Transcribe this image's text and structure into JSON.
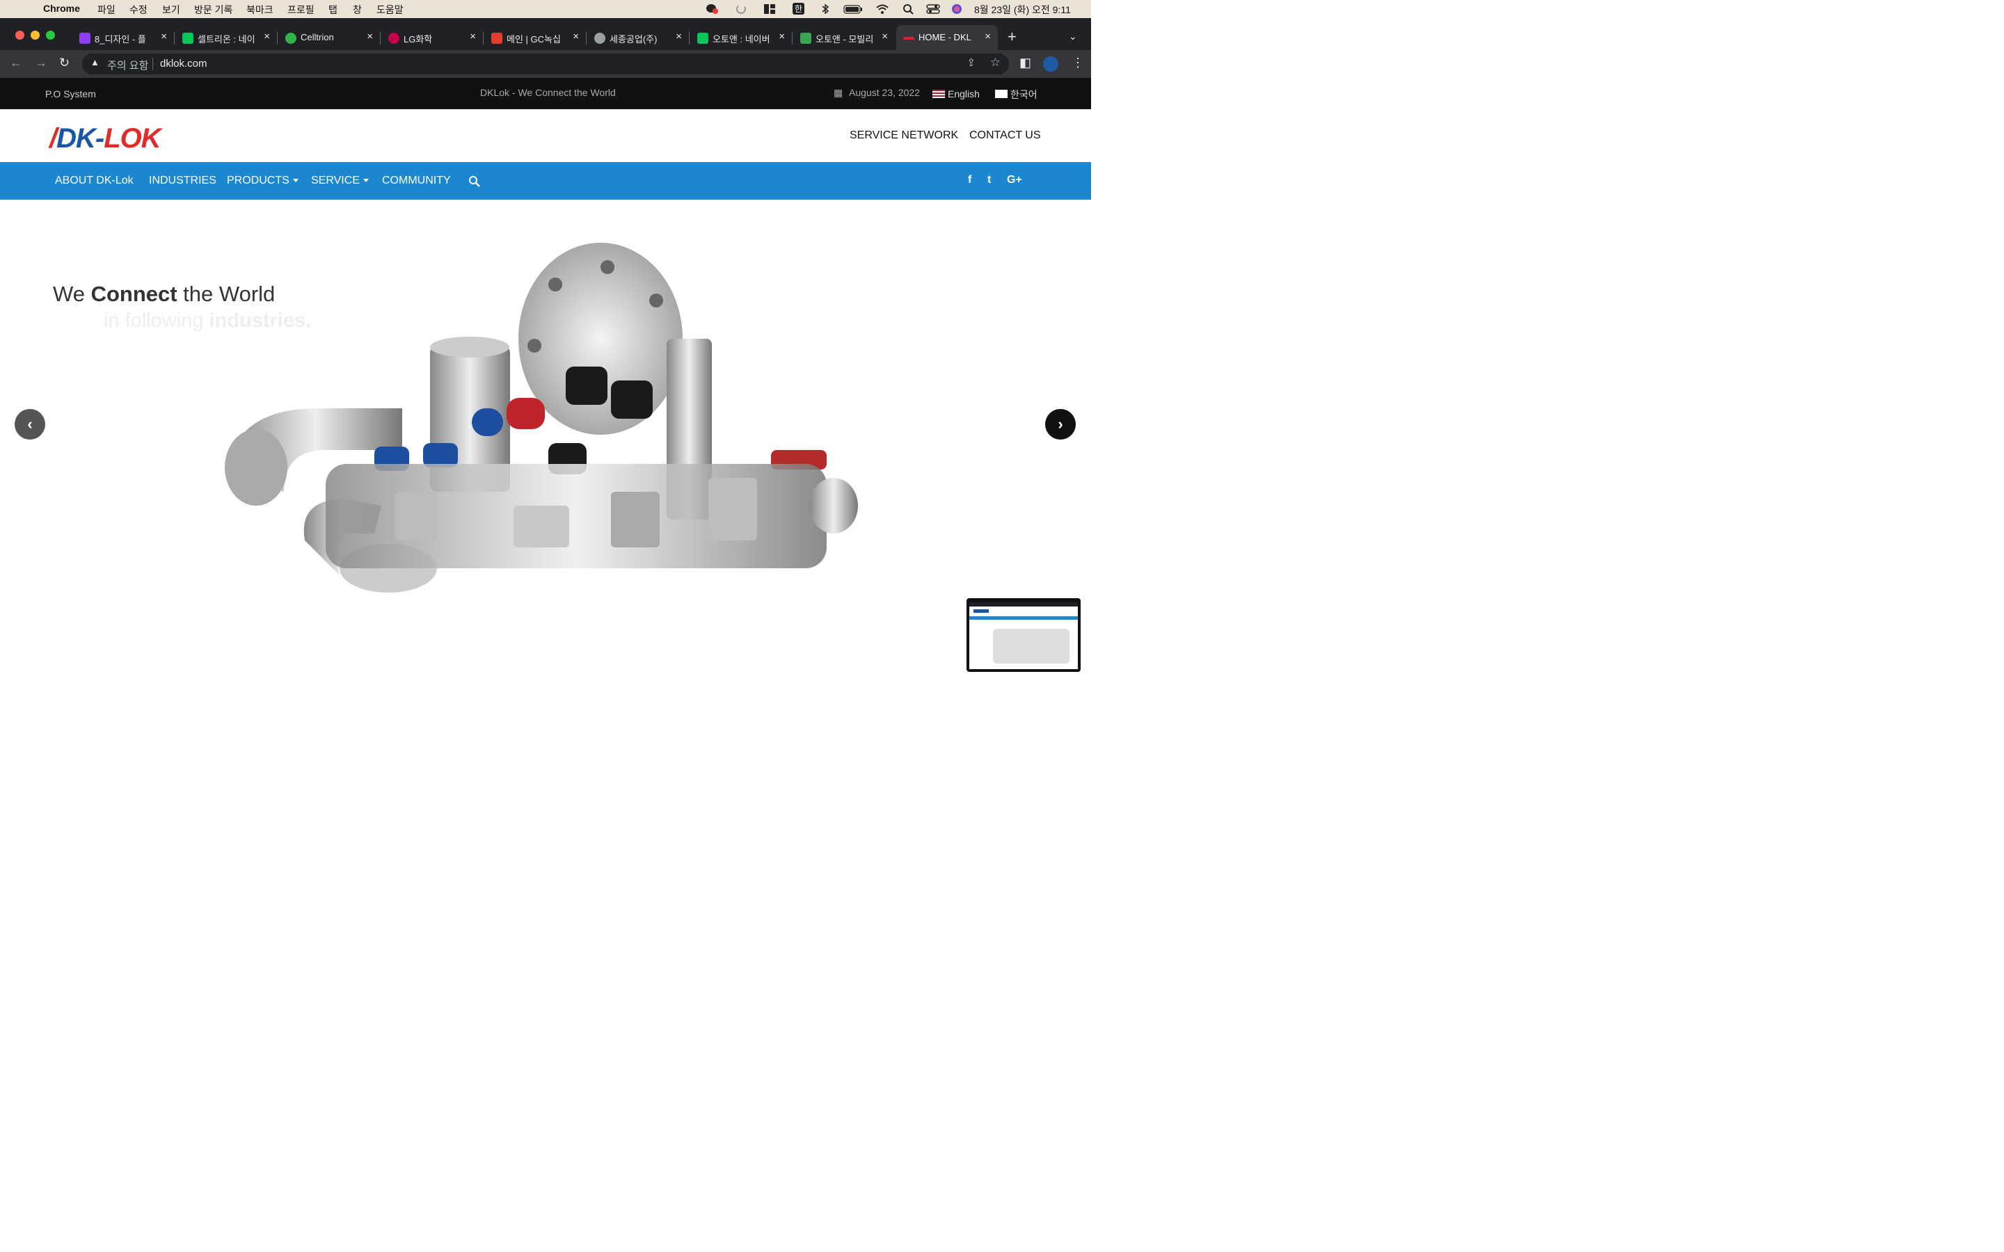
{
  "menubar": {
    "app_name": "Chrome",
    "menus": [
      "파일",
      "수정",
      "보기",
      "방문 기록",
      "북마크",
      "프로필",
      "탭",
      "창",
      "도움말"
    ],
    "ime_indicator": "한",
    "datetime": "8월 23일 (화) 오전 9:11"
  },
  "browser": {
    "tabs": [
      {
        "title": "8_디자인 - 플",
        "favicon_color": "#8e3ff5"
      },
      {
        "title": "셀트리온 : 네이",
        "favicon_color": "#03c75a"
      },
      {
        "title": "Celltrion",
        "favicon_color": "#32b44a"
      },
      {
        "title": "LG화학",
        "favicon_color": "#c5004f"
      },
      {
        "title": "메인 | GC녹십",
        "favicon_color": "#e63c2f"
      },
      {
        "title": "세종공업(주)",
        "favicon_color": "#9aa0a6"
      },
      {
        "title": "오토앤 : 네이버",
        "favicon_color": "#03c75a"
      },
      {
        "title": "오토앤 - 모빌리",
        "favicon_color": "#3aa655"
      },
      {
        "title": "HOME - DKL",
        "favicon_color": "#d6262b"
      }
    ],
    "security_label": "주의 요함",
    "url": "dklok.com"
  },
  "site": {
    "topbar": {
      "po_system": "P.O System",
      "tagline": "DKLok - We Connect the World",
      "date": "August 23, 2022",
      "lang_en": "English",
      "lang_ko": "한국어"
    },
    "logo": {
      "part1": "DK-",
      "part2": "LOK"
    },
    "header_links": {
      "service_network": "SERVICE NETWORK",
      "contact_us": "CONTACT US"
    },
    "nav": {
      "about": "ABOUT DK-Lok",
      "industries": "INDUSTRIES",
      "products": "PRODUCTS",
      "service": "SERVICE",
      "community": "COMMUNITY"
    },
    "social": {
      "facebook": "f",
      "twitter": "t",
      "google_plus": "G+"
    },
    "hero": {
      "line1_a": "We ",
      "line1_b": "Connect",
      "line1_c": " the World",
      "line2_a": "in following ",
      "line2_b": "industries."
    },
    "colors": {
      "nav_blue": "#1b87d0",
      "logo_blue": "#1a56a8",
      "logo_red": "#e02b2b"
    }
  }
}
